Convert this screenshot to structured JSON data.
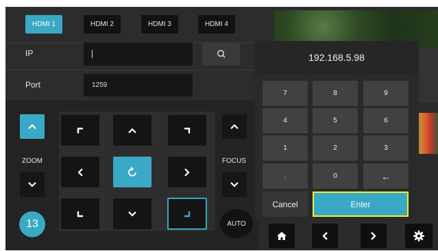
{
  "tabs": [
    {
      "label": "HDMI 1",
      "active": true
    },
    {
      "label": "HDMI 2",
      "active": false
    },
    {
      "label": "HDMI 3",
      "active": false
    },
    {
      "label": "HDMI 4",
      "active": false
    }
  ],
  "connection": {
    "ip_label": "IP",
    "ip_value": "",
    "port_label": "Port",
    "port_value": "1259"
  },
  "keypad": {
    "display": "192.168.5.98",
    "keys": [
      "7",
      "8",
      "9",
      "4",
      "5",
      "6",
      "1",
      "2",
      "3",
      ".",
      "0",
      "←"
    ],
    "cancel_label": "Cancel",
    "enter_label": "Enter"
  },
  "controls": {
    "zoom_label": "ZOOM",
    "focus_label": "FOCUS",
    "preset_number": "13",
    "auto_label": "AUTO"
  },
  "colors": {
    "accent": "#3aa9c5",
    "highlight": "#f2f02a",
    "panel": "#2b2b2b"
  },
  "icons": {
    "search": "search-icon",
    "home": "home-icon",
    "back": "chevron-left-icon",
    "forward": "chevron-right-icon",
    "settings": "gear-icon",
    "reset": "rotate-icon"
  }
}
